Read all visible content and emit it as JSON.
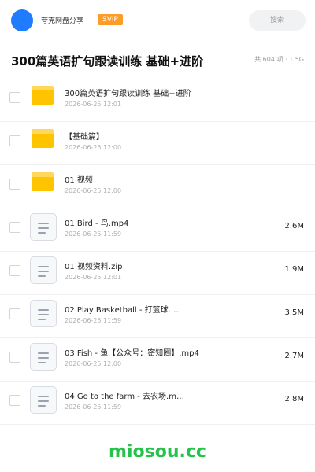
{
  "topbar": {
    "share_name": "夸克网盘分享",
    "svip": "SVIP",
    "search_label": "搜索"
  },
  "header": {
    "title": "300篇英语扩句跟读训练 基础+进阶",
    "meta": "共 604 项 · 1.5G"
  },
  "items": [
    {
      "type": "folder",
      "name": "300篇英语扩句跟读训练 基础+进阶",
      "date": "2026-06-25 12:01",
      "size": ""
    },
    {
      "type": "folder",
      "name": "【基础篇】",
      "date": "2026-06-25 12:00",
      "size": ""
    },
    {
      "type": "folder",
      "name": "01 视频",
      "date": "2026-06-25 12:00",
      "size": ""
    },
    {
      "type": "file",
      "name": "01 Bird - 鸟.mp4",
      "date": "2026-06-25 11:59",
      "size": "2.6M"
    },
    {
      "type": "file",
      "name": "01 视频资料.zip",
      "date": "2026-06-25 12:01",
      "size": "1.9M"
    },
    {
      "type": "file",
      "name": "02 Play Basketball - 打篮球.…",
      "date": "2026-06-25 11:59",
      "size": "3.5M"
    },
    {
      "type": "file",
      "name": "03 Fish - 鱼【公众号：密知圈】.mp4",
      "date": "2026-06-25 12:00",
      "size": "2.7M"
    },
    {
      "type": "file",
      "name": "04 Go to the farm - 去农场.m…",
      "date": "2026-06-25 11:59",
      "size": "2.8M"
    }
  ],
  "watermark": "miosou.cc",
  "colors": {
    "accent": "#1f7bff",
    "svip": "#ff9c28",
    "folder": "#ffc400",
    "watermark": "#27c24c"
  }
}
